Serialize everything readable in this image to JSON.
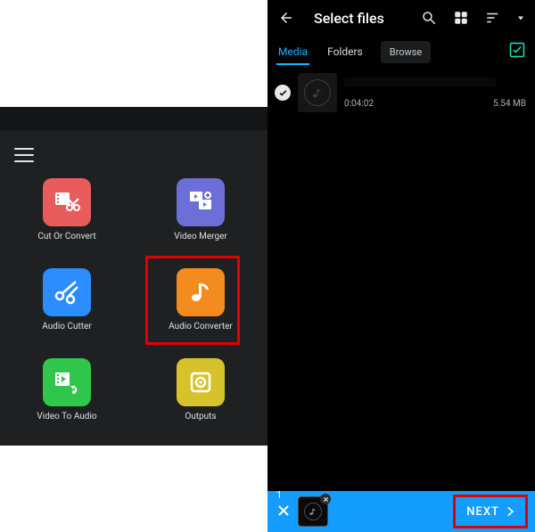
{
  "left": {
    "tools": [
      {
        "label": "Cut Or Convert"
      },
      {
        "label": "Video Merger"
      },
      {
        "label": "Audio Cutter"
      },
      {
        "label": "Audio Converter"
      },
      {
        "label": "Video To Audio"
      },
      {
        "label": "Outputs"
      }
    ]
  },
  "right": {
    "title": "Select files",
    "tabs": {
      "media": "Media",
      "folders": "Folders",
      "browse": "Browse"
    },
    "item": {
      "duration": "0:04:02",
      "size": "5.54 MB"
    },
    "bottom": {
      "count": "1",
      "next": "NEXT"
    }
  }
}
